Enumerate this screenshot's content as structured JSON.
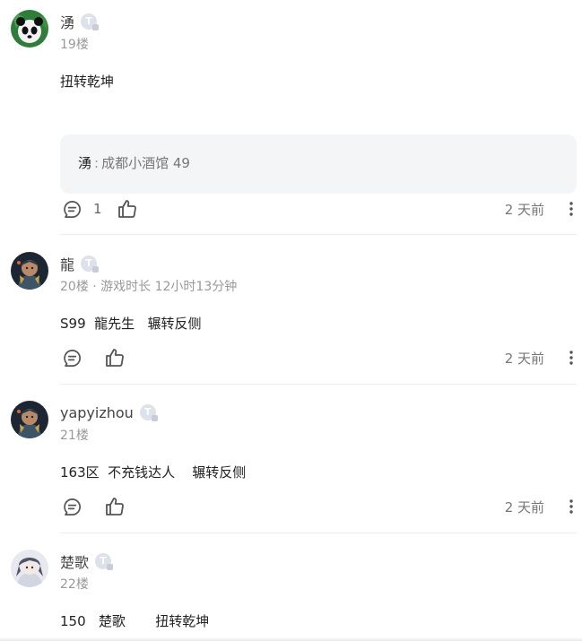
{
  "comments": [
    {
      "user": "湧",
      "badge": "T",
      "floor_info": "19楼",
      "content": "扭转乾坤",
      "quote": {
        "author": "湧",
        "separator": ":",
        "text": "成都小酒馆 49"
      },
      "reply_count": "1",
      "time": "2 天前",
      "avatar_theme": "panda"
    },
    {
      "user": "龍",
      "badge": "T",
      "floor_info": "20楼 · 游戏时长 12小时13分钟",
      "content": "S99  龍先生   辗转反侧",
      "time": "2 天前",
      "avatar_theme": "armored-hero"
    },
    {
      "user": "yapyizhou",
      "badge": "T",
      "floor_info": "21楼",
      "content": "163区  不充钱达人    辗转反侧",
      "time": "2 天前",
      "avatar_theme": "armored-hero"
    },
    {
      "user": "楚歌",
      "badge": "T",
      "floor_info": "22楼",
      "content": "150   楚歌       扭转乾坤",
      "avatar_theme": "anime-portrait"
    }
  ],
  "colors": {
    "text": "#222222",
    "muted": "#999999",
    "icon": "#555555",
    "quote_bg": "#f4f5f7",
    "divider": "#ededed"
  }
}
